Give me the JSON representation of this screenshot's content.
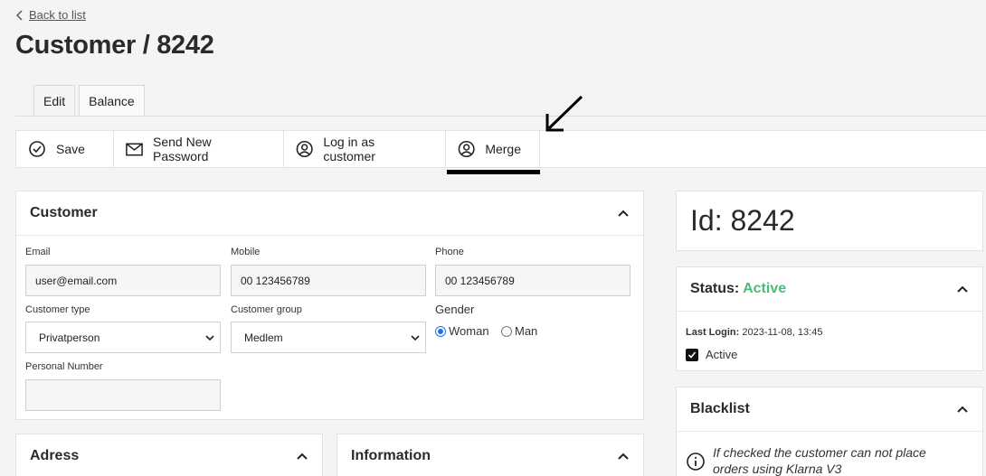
{
  "nav": {
    "back_label": "Back to list"
  },
  "page": {
    "title": "Customer / 8242"
  },
  "tabs": [
    {
      "label": "Edit",
      "active": true
    },
    {
      "label": "Balance",
      "active": false
    }
  ],
  "toolbar": {
    "save_label": "Save",
    "send_password_label": "Send New Password",
    "login_as_label": "Log in as customer",
    "merge_label": "Merge"
  },
  "customer_panel": {
    "title": "Customer",
    "email": {
      "label": "Email",
      "value": "user@email.com"
    },
    "mobile": {
      "label": "Mobile",
      "value": "00 123456789"
    },
    "phone": {
      "label": "Phone",
      "value": "00 123456789"
    },
    "customer_type": {
      "label": "Customer type",
      "value": "Privatperson"
    },
    "customer_group": {
      "label": "Customer group",
      "value": "Medlem"
    },
    "gender": {
      "label": "Gender",
      "options": [
        "Woman",
        "Man"
      ],
      "selected": "Woman"
    },
    "personal_number": {
      "label": "Personal Number",
      "value": ""
    }
  },
  "address_panel": {
    "title": "Adress"
  },
  "information_panel": {
    "title": "Information"
  },
  "id_panel": {
    "text": "Id: 8242"
  },
  "status_panel": {
    "label": "Status:",
    "value": "Active",
    "last_login_label": "Last Login:",
    "last_login_value": "2023-11-08, 13:45",
    "active_checkbox_label": "Active",
    "active_checked": true
  },
  "blacklist_panel": {
    "title": "Blacklist",
    "info_text_line1": "If checked the customer can not place",
    "info_text_line2": "orders using Klarna V3"
  },
  "colors": {
    "status_active": "#4cbb7a",
    "radio_selected": "#1a73e8"
  }
}
